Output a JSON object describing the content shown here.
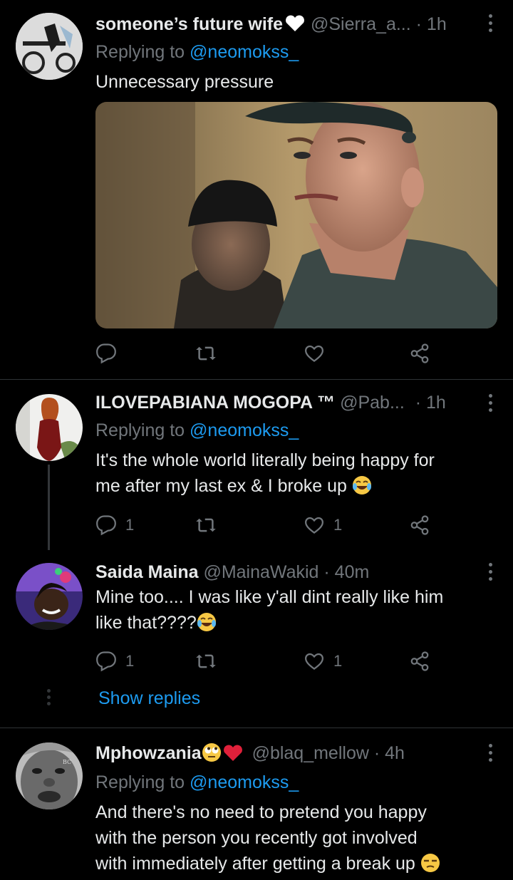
{
  "colors": {
    "background": "#000000",
    "text": "#e7e9ea",
    "muted": "#71767b",
    "accent": "#1d9bf0",
    "divider": "#2f3336"
  },
  "tweets": [
    {
      "name": "someone’s future wife",
      "name_emoji": "white-heart",
      "handle": "@Sierra_a...",
      "time": "· 1h",
      "replying_label": "Replying to",
      "replying_to": "@neomokss_",
      "text": "Unnecessary pressure",
      "media": "gif-still-man-in-cap-grimacing",
      "reply_count": "",
      "like_count": ""
    },
    {
      "name": "ILOVEPABIANA MOGOPA ™",
      "handle": "@Pab...",
      "time": "· 1h",
      "replying_label": "Replying to",
      "replying_to": "@neomokss_",
      "text_line1": "It's the whole world literally being happy for",
      "text_line2": "me after my last ex & I broke up",
      "text_emoji": "tears-of-joy",
      "reply_count": "1",
      "like_count": "1"
    },
    {
      "name": "Saida Maina",
      "handle": "@MainaWakid",
      "time": "· 40m",
      "text_line1": "Mine too.... I was like y'all dint really like him",
      "text_line2": "like that????",
      "text_emoji": "tears-of-joy",
      "reply_count": "1",
      "like_count": "1",
      "show_replies": "Show replies"
    },
    {
      "name": "Mphowzania",
      "name_emoji": "rolling-eyes-and-red-heart",
      "handle": "@blaq_mellow",
      "time": "· 4h",
      "replying_label": "Replying to",
      "replying_to": "@neomokss_",
      "text_line1": "And there's no need to pretend you happy",
      "text_line2": "with the person you recently got involved",
      "text_line3": "with immediately after getting a  break up",
      "text_emoji": "unamused-face"
    }
  ]
}
